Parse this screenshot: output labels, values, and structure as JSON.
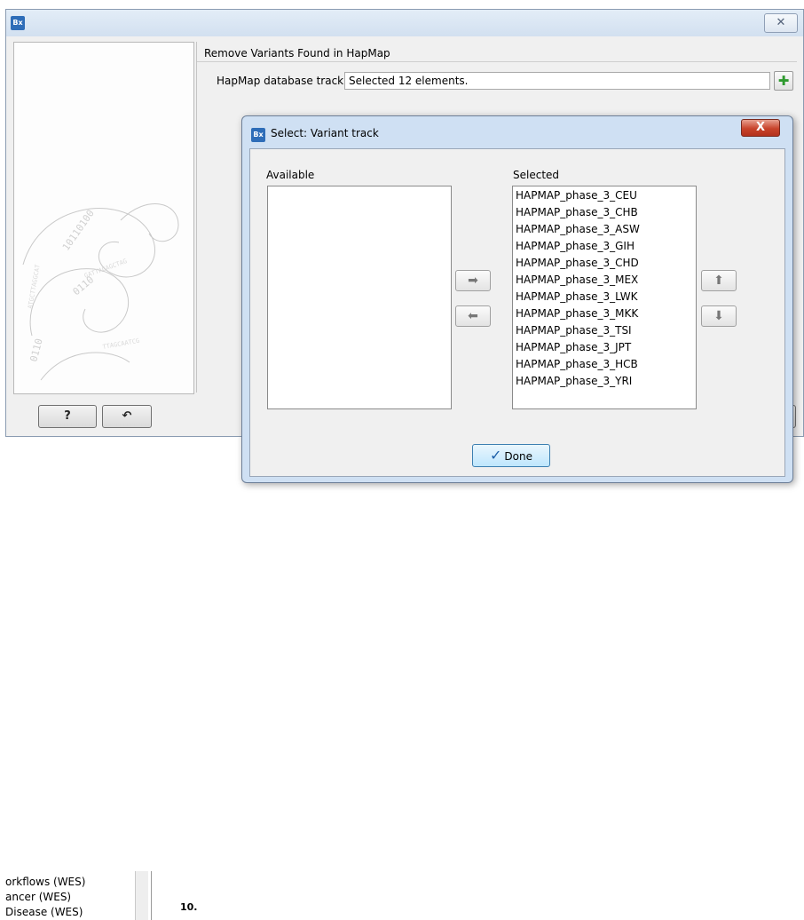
{
  "wizard": {
    "app_icon": "Bx",
    "close_symbol": "✕",
    "section_title": "Remove Variants Found in HapMap",
    "field_label": "HapMap database track",
    "field_value": "Selected 12 elements.",
    "add_symbol": "✚",
    "help_label": "?",
    "reset_symbol": "↶",
    "next_label": "",
    "accent_color": "#2e6db8"
  },
  "background_app": {
    "list_items": [
      "orkflows (WES)",
      "ancer (WES)",
      "Disease (WES)"
    ],
    "canvas_number": "10."
  },
  "dialog": {
    "app_icon": "Bx",
    "title": "Select: Variant track",
    "close_symbol": "X",
    "available_label": "Available",
    "selected_label": "Selected",
    "available_items": [],
    "selected_items": [
      "HAPMAP_phase_3_CEU",
      "HAPMAP_phase_3_CHB",
      "HAPMAP_phase_3_ASW",
      "HAPMAP_phase_3_GIH",
      "HAPMAP_phase_3_CHD",
      "HAPMAP_phase_3_MEX",
      "HAPMAP_phase_3_LWK",
      "HAPMAP_phase_3_MKK",
      "HAPMAP_phase_3_TSI",
      "HAPMAP_phase_3_JPT",
      "HAPMAP_phase_3_HCB",
      "HAPMAP_phase_3_YRI"
    ],
    "add_symbol": "➡",
    "remove_symbol": "⬅",
    "up_symbol": "⬆",
    "down_symbol": "⬇",
    "done_check": "✓",
    "done_label": "Done",
    "close_color": "#c8432b"
  }
}
